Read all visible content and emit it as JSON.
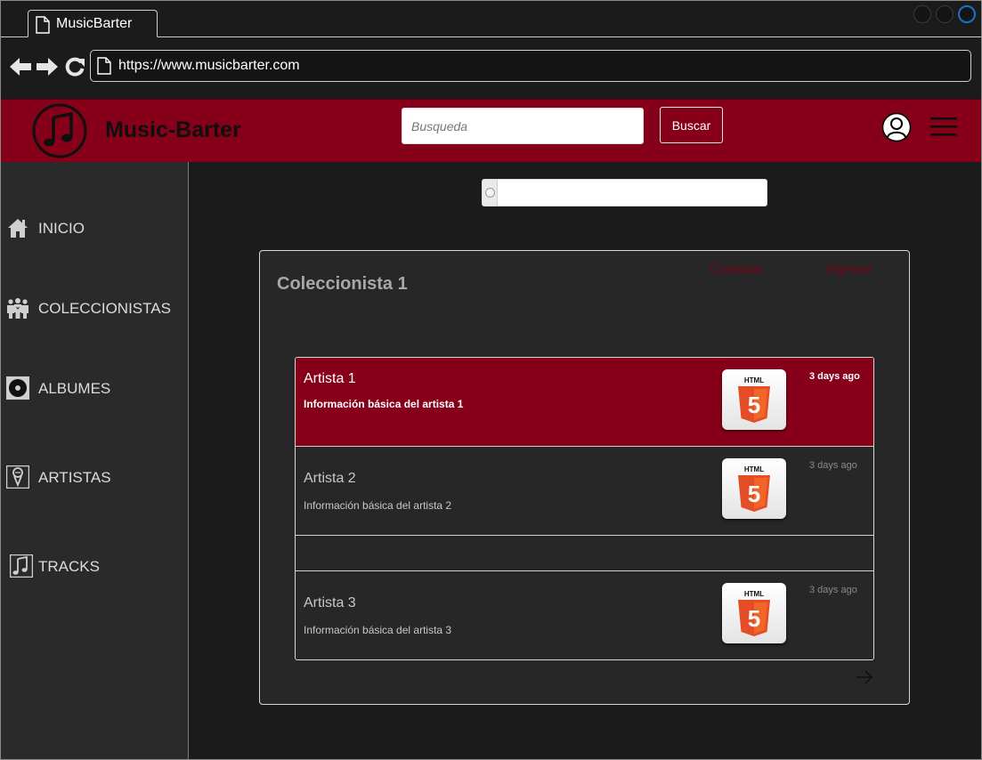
{
  "browser": {
    "tab_title": "MusicBarter",
    "url": "https://www.musicbarter.com"
  },
  "header": {
    "brand": "Music-Barter",
    "search_placeholder": "Busqueda",
    "search_button": "Buscar"
  },
  "sidebar": {
    "items": [
      {
        "label": "INICIO",
        "icon": "home-icon"
      },
      {
        "label": "COLECCIONISTAS",
        "icon": "people-icon"
      },
      {
        "label": "ALBUMES",
        "icon": "disc-icon"
      },
      {
        "label": "ARTISTAS",
        "icon": "microphone-icon"
      },
      {
        "label": "TRACKS",
        "icon": "music-note-icon"
      }
    ]
  },
  "card": {
    "title": "Coleccionista 1",
    "links": [
      "Contactar",
      "Ingresar"
    ],
    "artists": [
      {
        "name": "Artista 1",
        "info": "Información básica del artista 1",
        "time": "3 days ago",
        "thumb_label": "HTML",
        "thumb_digit": "5"
      },
      {
        "name": "Artista 2",
        "info": "Información básica del artista 2",
        "time": "3 days ago",
        "thumb_label": "HTML",
        "thumb_digit": "5"
      },
      {
        "name": "Artista 3",
        "info": "Información básica del artista 3",
        "time": "3 days ago",
        "thumb_label": "HTML",
        "thumb_digit": "5"
      }
    ]
  },
  "colors": {
    "brand_red": "#860019",
    "background": "#1b1b1b",
    "sidebar": "#2a2a2a",
    "card": "#272727",
    "html5_orange": "#e44d26"
  }
}
